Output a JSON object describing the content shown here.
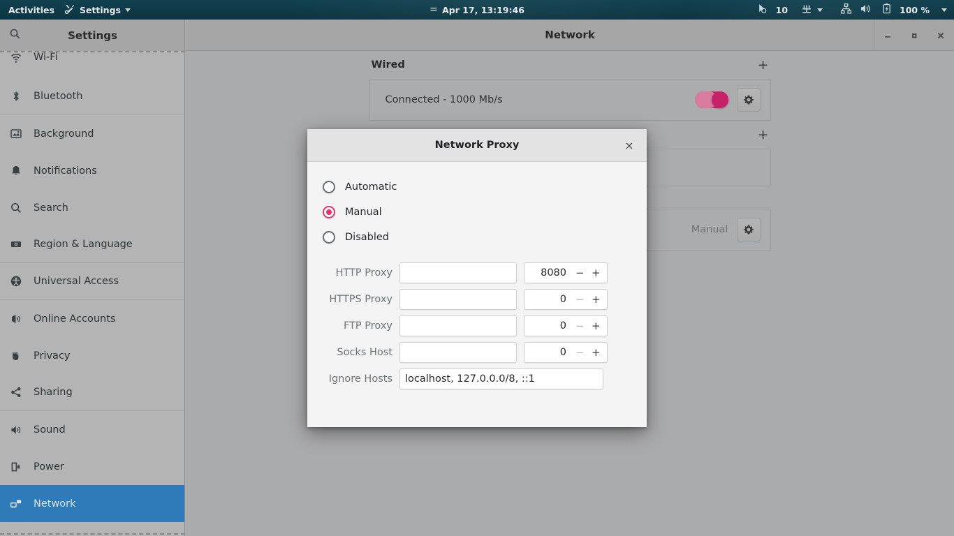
{
  "topbar": {
    "activities": "Activities",
    "app_menu": {
      "label": "Settings",
      "icon": "tools-icon"
    },
    "clock": {
      "icon": "notifications-indicator-icon",
      "text": "Apr 17, 13:19:46"
    },
    "indicators": {
      "workspace_icon": "accessibility-pointer-icon",
      "workspace_count": "10",
      "keyboard_icon": "input-method-icon",
      "network_icon": "wired-network-icon",
      "volume_icon": "volume-icon",
      "battery_icon": "battery-charging-icon",
      "battery_text": "100 %"
    }
  },
  "sidebar": {
    "title": "Settings",
    "search_icon": "search-icon",
    "items": [
      {
        "label": "Wi-Fi",
        "icon": "wifi-icon"
      },
      {
        "label": "Bluetooth",
        "icon": "bluetooth-icon"
      },
      {
        "label": "Background",
        "icon": "background-icon"
      },
      {
        "label": "Notifications",
        "icon": "bell-icon"
      },
      {
        "label": "Search",
        "icon": "search-icon"
      },
      {
        "label": "Region & Language",
        "icon": "region-language-icon"
      },
      {
        "label": "Universal Access",
        "icon": "universal-access-icon"
      },
      {
        "label": "Online Accounts",
        "icon": "online-accounts-icon"
      },
      {
        "label": "Privacy",
        "icon": "privacy-hand-icon"
      },
      {
        "label": "Sharing",
        "icon": "sharing-icon"
      },
      {
        "label": "Sound",
        "icon": "sound-icon"
      },
      {
        "label": "Power",
        "icon": "power-icon"
      },
      {
        "label": "Network",
        "icon": "network-icon"
      }
    ],
    "selected": "Network"
  },
  "window": {
    "title": "Network",
    "controls": {
      "minimize": "minimize-icon",
      "maximize": "maximize-icon",
      "close": "close-icon"
    }
  },
  "network_page": {
    "wired": {
      "heading": "Wired",
      "add_label": "+",
      "status": "Connected - 1000 Mb/s",
      "toggle_on": true,
      "settings_icon": "gear-icon"
    },
    "second_section": {
      "add_label": "+"
    },
    "proxy_row": {
      "value": "Manual",
      "settings_icon": "gear-icon"
    }
  },
  "dialog": {
    "title": "Network Proxy",
    "close_label": "×",
    "modes": [
      {
        "label": "Automatic",
        "selected": false
      },
      {
        "label": "Manual",
        "selected": true
      },
      {
        "label": "Disabled",
        "selected": false
      }
    ],
    "fields": [
      {
        "label": "HTTP Proxy",
        "host": "",
        "port": "8080",
        "minus": "−",
        "plus": "+",
        "minus_dim": false
      },
      {
        "label": "HTTPS Proxy",
        "host": "",
        "port": "0",
        "minus": "−",
        "plus": "+",
        "minus_dim": true
      },
      {
        "label": "FTP Proxy",
        "host": "",
        "port": "0",
        "minus": "−",
        "plus": "+",
        "minus_dim": true
      },
      {
        "label": "Socks Host",
        "host": "",
        "port": "0",
        "minus": "−",
        "plus": "+",
        "minus_dim": true
      }
    ],
    "ignore_hosts": {
      "label": "Ignore Hosts",
      "value": "localhost, 127.0.0.0/8, ::1"
    }
  },
  "colors": {
    "topbar_bg": "#0d3b4a",
    "accent_pink": "#e8336d",
    "toggle_on": "#c9206a",
    "selection_blue": "#2f7ab8",
    "window_bg": "#aaabac",
    "dialog_bg": "#f4f4f4"
  }
}
